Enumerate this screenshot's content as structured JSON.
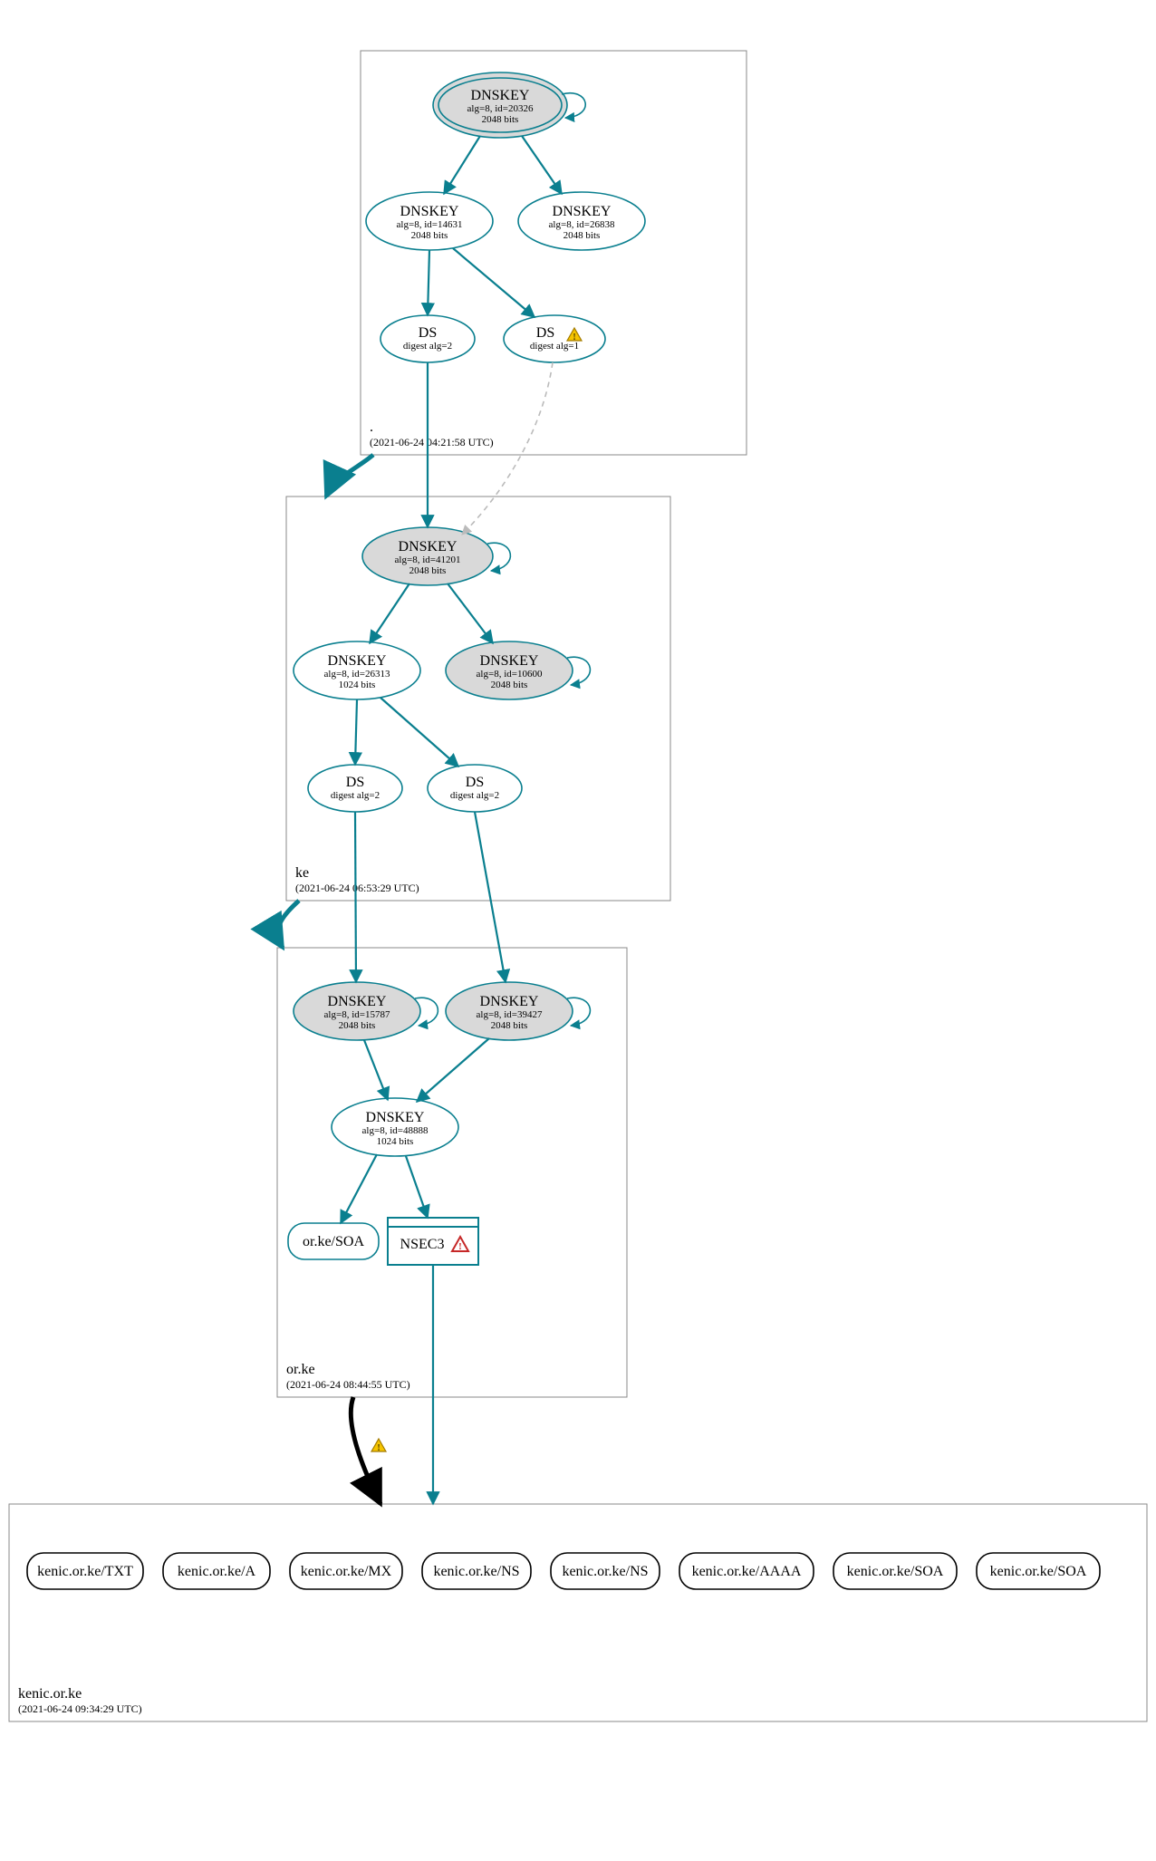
{
  "zones": {
    "root": {
      "name": ".",
      "time": "(2021-06-24 04:21:58 UTC)"
    },
    "ke": {
      "name": "ke",
      "time": "(2021-06-24 06:53:29 UTC)"
    },
    "orke": {
      "name": "or.ke",
      "time": "(2021-06-24 08:44:55 UTC)"
    },
    "kenic": {
      "name": "kenic.or.ke",
      "time": "(2021-06-24 09:34:29 UTC)"
    }
  },
  "nodes": {
    "root_ksk": {
      "t": "DNSKEY",
      "s1": "alg=8, id=20326",
      "s2": "2048 bits"
    },
    "root_zsk1": {
      "t": "DNSKEY",
      "s1": "alg=8, id=14631",
      "s2": "2048 bits"
    },
    "root_zsk2": {
      "t": "DNSKEY",
      "s1": "alg=8, id=26838",
      "s2": "2048 bits"
    },
    "root_ds1": {
      "t": "DS",
      "s1": "digest alg=2",
      "s2": ""
    },
    "root_ds2": {
      "t": "DS",
      "s1": "digest alg=1",
      "s2": ""
    },
    "ke_ksk": {
      "t": "DNSKEY",
      "s1": "alg=8, id=41201",
      "s2": "2048 bits"
    },
    "ke_zsk": {
      "t": "DNSKEY",
      "s1": "alg=8, id=26313",
      "s2": "1024 bits"
    },
    "ke_other": {
      "t": "DNSKEY",
      "s1": "alg=8, id=10600",
      "s2": "2048 bits"
    },
    "ke_ds1": {
      "t": "DS",
      "s1": "digest alg=2",
      "s2": ""
    },
    "ke_ds2": {
      "t": "DS",
      "s1": "digest alg=2",
      "s2": ""
    },
    "orke_ksk1": {
      "t": "DNSKEY",
      "s1": "alg=8, id=15787",
      "s2": "2048 bits"
    },
    "orke_ksk2": {
      "t": "DNSKEY",
      "s1": "alg=8, id=39427",
      "s2": "2048 bits"
    },
    "orke_zsk": {
      "t": "DNSKEY",
      "s1": "alg=8, id=48888",
      "s2": "1024 bits"
    },
    "orke_soa": {
      "t": "or.ke/SOA"
    },
    "orke_nsec3": {
      "t": "NSEC3"
    },
    "kenic_txt": {
      "t": "kenic.or.ke/TXT"
    },
    "kenic_a": {
      "t": "kenic.or.ke/A"
    },
    "kenic_mx": {
      "t": "kenic.or.ke/MX"
    },
    "kenic_ns1": {
      "t": "kenic.or.ke/NS"
    },
    "kenic_ns2": {
      "t": "kenic.or.ke/NS"
    },
    "kenic_aaaa": {
      "t": "kenic.or.ke/AAAA"
    },
    "kenic_soa1": {
      "t": "kenic.or.ke/SOA"
    },
    "kenic_soa2": {
      "t": "kenic.or.ke/SOA"
    }
  },
  "colors": {
    "teal": "#0a7f8f",
    "grey_fill": "#d9d9d9",
    "box_stroke": "#888888",
    "warn_yellow": "#f5c400",
    "warn_red": "#c62828",
    "dashed_grey": "#bbbbbb"
  }
}
